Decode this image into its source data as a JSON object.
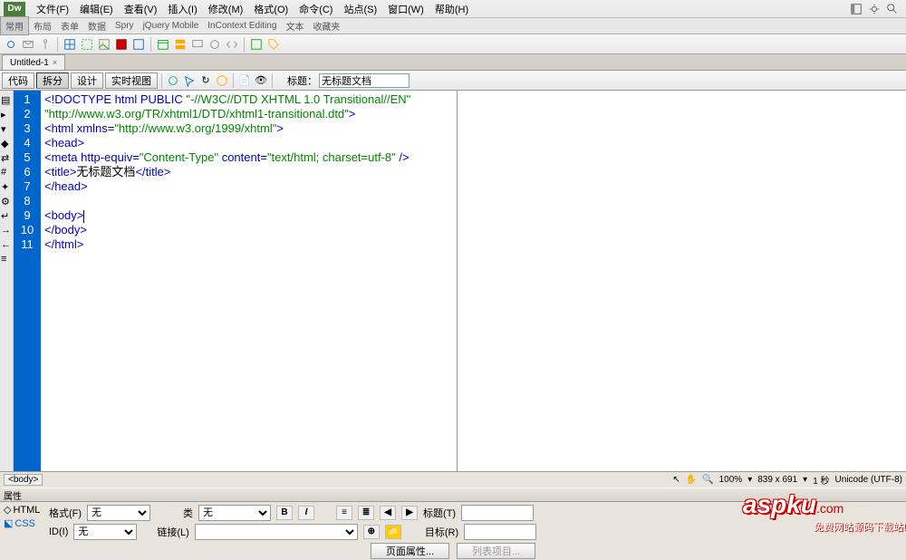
{
  "menubar": {
    "items": [
      "文件(F)",
      "编辑(E)",
      "查看(V)",
      "插入(I)",
      "修改(M)",
      "格式(O)",
      "命令(C)",
      "站点(S)",
      "窗口(W)",
      "帮助(H)"
    ]
  },
  "tabstrip": {
    "items": [
      "常用",
      "布局",
      "表单",
      "数据",
      "Spry",
      "jQuery Mobile",
      "InContext Editing",
      "文本",
      "收藏夹"
    ]
  },
  "doc_tab": {
    "label": "Untitled-1"
  },
  "view_buttons": [
    "代码",
    "拆分",
    "设计",
    "实时视图"
  ],
  "title_field": {
    "label": "标题：",
    "value": "无标题文档"
  },
  "code": {
    "lines": [
      {
        "n": 1,
        "html": "<span class='c-blue'>&lt;!DOCTYPE html PUBLIC </span><span class='c-green'>\"-//W3C//DTD XHTML 1.0 Transitional//EN\"</span>"
      },
      {
        "n": "",
        "html": "<span class='c-green'>\"http://www.w3.org/TR/xhtml1/DTD/xhtml1-transitional.dtd\"</span><span class='c-blue'>&gt;</span>"
      },
      {
        "n": 2,
        "html": "<span class='c-blue'>&lt;html xmlns=</span><span class='c-green'>\"http://www.w3.org/1999/xhtml\"</span><span class='c-blue'>&gt;</span>"
      },
      {
        "n": 3,
        "html": "<span class='c-blue'>&lt;head&gt;</span>"
      },
      {
        "n": 4,
        "html": "<span class='c-blue'>&lt;meta http-equiv=</span><span class='c-green'>\"Content-Type\"</span><span class='c-blue'> content=</span><span class='c-green'>\"text/html; charset=utf-8\"</span><span class='c-blue'> /&gt;</span>"
      },
      {
        "n": 5,
        "html": "<span class='c-blue'>&lt;title&gt;</span><span class='c-text'>无标题文档</span><span class='c-blue'>&lt;/title&gt;</span>"
      },
      {
        "n": 6,
        "html": "<span class='c-blue'>&lt;/head&gt;</span>"
      },
      {
        "n": 7,
        "html": ""
      },
      {
        "n": 8,
        "html": "<span class='c-blue'>&lt;body&gt;</span><span class='cursor'></span>"
      },
      {
        "n": 9,
        "html": "<span class='c-blue'>&lt;/body&gt;</span>"
      },
      {
        "n": 10,
        "html": "<span class='c-blue'>&lt;/html&gt;</span>"
      },
      {
        "n": 11,
        "html": ""
      }
    ]
  },
  "status": {
    "tag": "<body>",
    "zoom": "100%",
    "dims": "839 x 691",
    "time": "1 秒",
    "encoding": "Unicode (UTF-8)"
  },
  "props": {
    "header": "属性",
    "html_label": "HTML",
    "css_label": "CSS",
    "format_label": "格式(F)",
    "format_value": "无",
    "class_label": "类",
    "class_value": "无",
    "id_label": "ID(I)",
    "id_value": "无",
    "link_label": "链接(L)",
    "link_value": "",
    "title_label": "标题(T)",
    "target_label": "目标(R)"
  },
  "bottom": {
    "page_props": "页面属性...",
    "list_items": "列表项目..."
  },
  "watermark": {
    "brand": "aspku",
    "dotcom": ".com",
    "tagline": "免费网站源码下载站!"
  }
}
